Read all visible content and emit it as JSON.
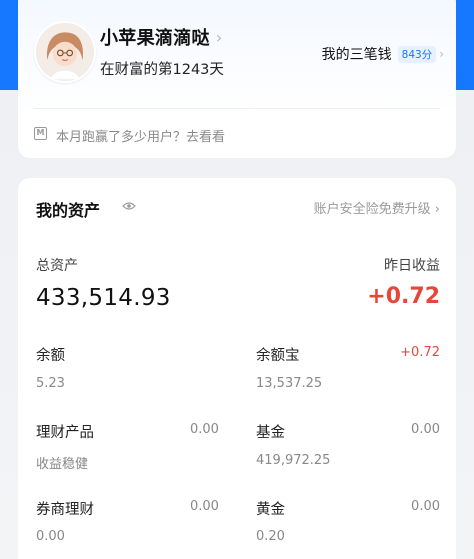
{
  "profile": {
    "name": "小苹果滴滴哒",
    "days": "在财富的第1243天",
    "sanbi_label": "我的三笔钱",
    "sanbi_score": "843分",
    "promo": "本月跑赢了多少用户？去看看",
    "promo_icon": "M"
  },
  "assets": {
    "title": "我的资产",
    "upgrade": "账户安全险免费升级",
    "total_label": "总资产",
    "total_value": "433,514.93",
    "yesterday_label": "昨日收益",
    "yesterday_value": "+0.72",
    "items": [
      {
        "label": "余额",
        "value": "5.23",
        "change": ""
      },
      {
        "label": "余额宝",
        "value": "13,537.25",
        "change": "+0.72"
      },
      {
        "label": "理财产品",
        "value": "收益稳健",
        "change": "0.00"
      },
      {
        "label": "基金",
        "value": "419,972.25",
        "change": "0.00"
      },
      {
        "label": "券商理财",
        "value": "0.00",
        "change": "0.00"
      },
      {
        "label": "黄金",
        "value": "0.20",
        "change": "0.00"
      }
    ]
  },
  "colors": {
    "brand_blue": "#1677ff",
    "gain_red": "#e5483a"
  },
  "icons": {
    "avatar": "avatar",
    "eye": "eye-icon",
    "chevron": "chevron-right-icon",
    "promo": "m-icon"
  }
}
